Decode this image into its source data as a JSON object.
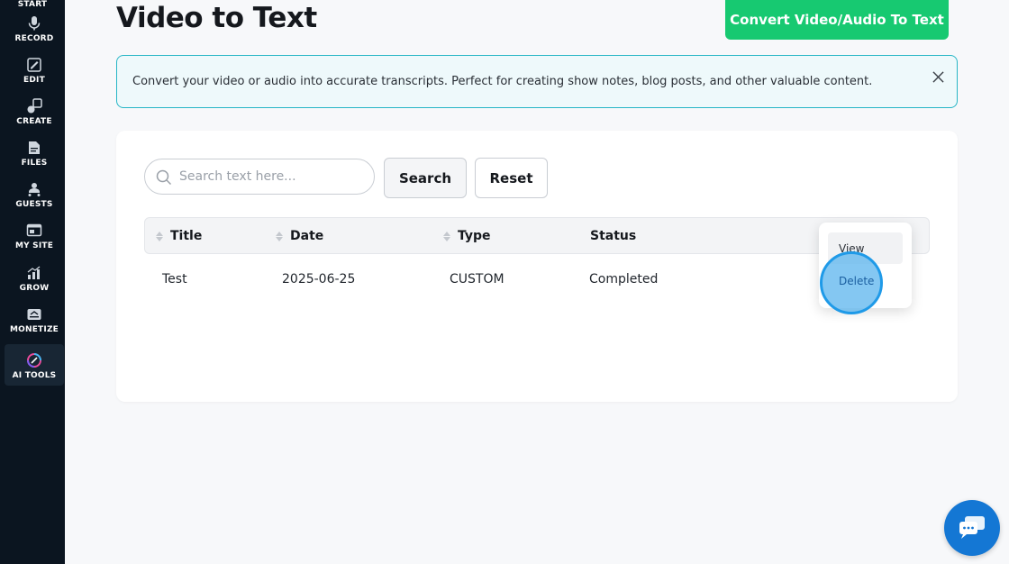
{
  "sidebar": {
    "items": [
      {
        "label": "START"
      },
      {
        "label": "RECORD",
        "icon": "microphone-icon"
      },
      {
        "label": "EDIT",
        "icon": "edit-icon"
      },
      {
        "label": "CREATE",
        "icon": "create-icon"
      },
      {
        "label": "FILES",
        "icon": "files-icon"
      },
      {
        "label": "GUESTS",
        "icon": "guests-icon"
      },
      {
        "label": "MY SITE",
        "icon": "site-icon"
      },
      {
        "label": "GROW",
        "icon": "grow-icon"
      },
      {
        "label": "MONETIZE",
        "icon": "monetize-icon"
      },
      {
        "label": "AI TOOLS",
        "icon": "ai-tools-icon",
        "active": true
      }
    ]
  },
  "header": {
    "title": "Video to Text",
    "convert_label": "Convert Video/Audio To Text"
  },
  "banner": {
    "text": "Convert your video or audio into accurate transcripts. Perfect for creating show notes, blog posts, and other valuable content."
  },
  "search": {
    "placeholder": "Search text here...",
    "value": "",
    "search_label": "Search",
    "reset_label": "Reset"
  },
  "table": {
    "columns": [
      "Title",
      "Date",
      "Type",
      "Status"
    ],
    "rows": [
      {
        "title": "Test",
        "date": "2025-06-25",
        "type": "CUSTOM",
        "status": "Completed"
      }
    ]
  },
  "menu": {
    "view_label": "View",
    "delete_label": "Delete"
  },
  "colors": {
    "sidebar_bg": "#0b1520",
    "accent_green": "#17c971",
    "banner_border": "#27b6c6",
    "chat_blue": "#1477d4"
  }
}
